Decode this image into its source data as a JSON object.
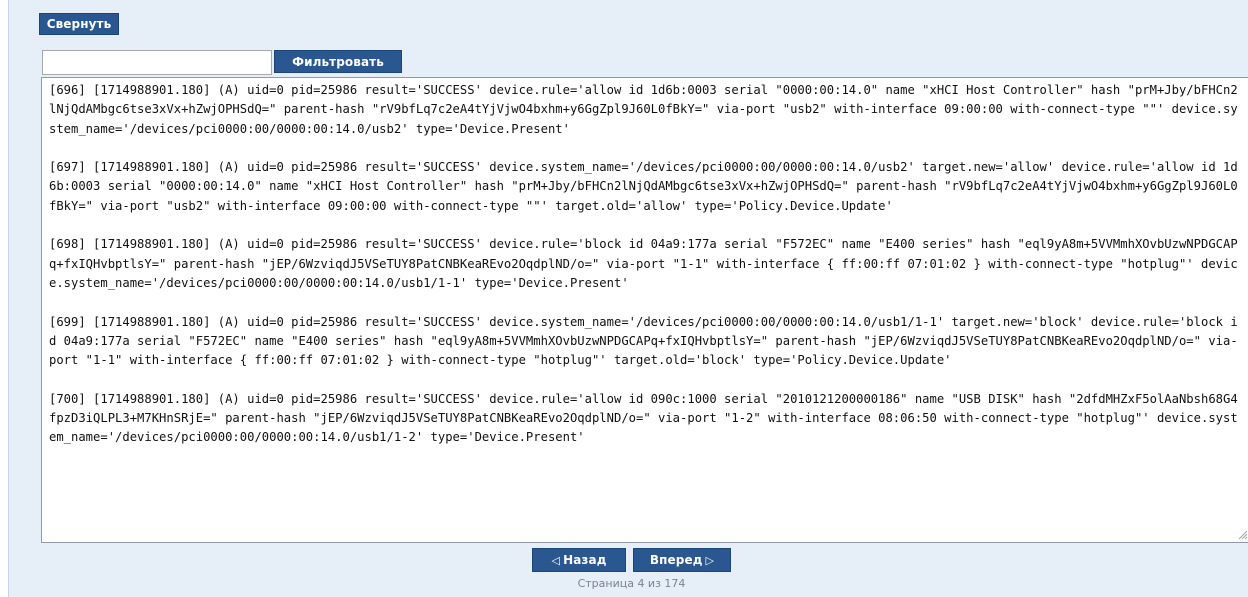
{
  "toolbar": {
    "collapse_label": "Свернуть",
    "filter_label": "Фильтровать",
    "filter_value": "",
    "filter_placeholder": ""
  },
  "log_entries": [
    "[696] [1714988901.180] (A) uid=0 pid=25986 result='SUCCESS' device.rule='allow id 1d6b:0003 serial \"0000:00:14.0\" name \"xHCI Host Controller\" hash \"prM+Jby/bFHCn2lNjQdAMbgc6tse3xVx+hZwjOPHSdQ=\" parent-hash \"rV9bfLq7c2eA4tYjVjwO4bxhm+y6GgZpl9J60L0fBkY=\" via-port \"usb2\" with-interface 09:00:00 with-connect-type \"\"' device.system_name='/devices/pci0000:00/0000:00:14.0/usb2' type='Device.Present'",
    "[697] [1714988901.180] (A) uid=0 pid=25986 result='SUCCESS' device.system_name='/devices/pci0000:00/0000:00:14.0/usb2' target.new='allow' device.rule='allow id 1d6b:0003 serial \"0000:00:14.0\" name \"xHCI Host Controller\" hash \"prM+Jby/bFHCn2lNjQdAMbgc6tse3xVx+hZwjOPHSdQ=\" parent-hash \"rV9bfLq7c2eA4tYjVjwO4bxhm+y6GgZpl9J60L0fBkY=\" via-port \"usb2\" with-interface 09:00:00 with-connect-type \"\"' target.old='allow' type='Policy.Device.Update'",
    "[698] [1714988901.180] (A) uid=0 pid=25986 result='SUCCESS' device.rule='block id 04a9:177a serial \"F572EC\" name \"E400 series\" hash \"eql9yA8m+5VVMmhXOvbUzwNPDGCAPq+fxIQHvbptlsY=\" parent-hash \"jEP/6WzviqdJ5VSeTUY8PatCNBKeaREvo2OqdplND/o=\" via-port \"1-1\" with-interface { ff:00:ff 07:01:02 } with-connect-type \"hotplug\"' device.system_name='/devices/pci0000:00/0000:00:14.0/usb1/1-1' type='Device.Present'",
    "[699] [1714988901.180] (A) uid=0 pid=25986 result='SUCCESS' device.system_name='/devices/pci0000:00/0000:00:14.0/usb1/1-1' target.new='block' device.rule='block id 04a9:177a serial \"F572EC\" name \"E400 series\" hash \"eql9yA8m+5VVMmhXOvbUzwNPDGCAPq+fxIQHvbptlsY=\" parent-hash \"jEP/6WzviqdJ5VSeTUY8PatCNBKeaREvo2OqdplND/o=\" via-port \"1-1\" with-interface { ff:00:ff 07:01:02 } with-connect-type \"hotplug\"' target.old='block' type='Policy.Device.Update'",
    "[700] [1714988901.180] (A) uid=0 pid=25986 result='SUCCESS' device.rule='allow id 090c:1000 serial \"2010121200000186\" name \"USB DISK\" hash \"2dfdMHZxF5olAaNbsh68G4fpzD3iQLPL3+M7KHnSRjE=\" parent-hash \"jEP/6WzviqdJ5VSeTUY8PatCNBKeaREvo2OqdplND/o=\" via-port \"1-2\" with-interface 08:06:50 with-connect-type \"hotplug\"' device.system_name='/devices/pci0000:00/0000:00:14.0/usb1/1-2' type='Device.Present'"
  ],
  "pagination": {
    "prev_label": "Назад",
    "next_label": "Вперед",
    "prev_icon": "triangle-left-icon",
    "next_icon": "triangle-right-icon",
    "page_info": "Страница 4 из 174"
  },
  "colors": {
    "button_bg": "#2a578f",
    "panel_bg": "#e6eef7",
    "page_info_text": "#7a8390"
  }
}
